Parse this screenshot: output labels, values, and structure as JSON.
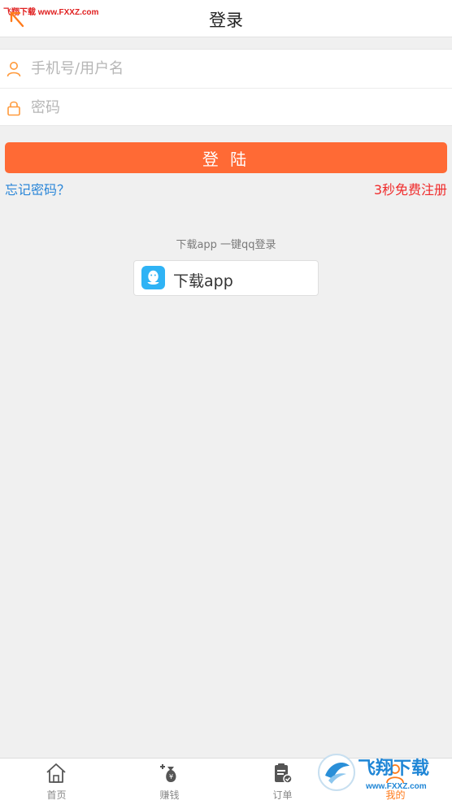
{
  "watermark_top": "飞翔下载 www.FXXZ.com",
  "header": {
    "title": "登录"
  },
  "form": {
    "username_placeholder": "手机号/用户名",
    "password_placeholder": "密码"
  },
  "login_button": "登 陆",
  "links": {
    "forgot": "忘记密码？",
    "register": "3秒免费注册"
  },
  "qq_hint": "下载app 一键qq登录",
  "download_button": "下载app",
  "tabs": [
    {
      "label": "首页",
      "icon": "home-icon"
    },
    {
      "label": "赚钱",
      "icon": "money-bag-icon"
    },
    {
      "label": "订单",
      "icon": "order-clipboard-icon"
    },
    {
      "label": "我的",
      "icon": "user-icon",
      "active": true
    }
  ],
  "watermark_logo": {
    "name": "飞翔下载",
    "url": "www.FXXZ.com"
  },
  "colors": {
    "accent": "#ff6a35",
    "link_blue": "#2a86d8",
    "link_red": "#f02b2b",
    "qq_blue": "#2fb3f5",
    "tab_active": "#ff7a1a"
  }
}
